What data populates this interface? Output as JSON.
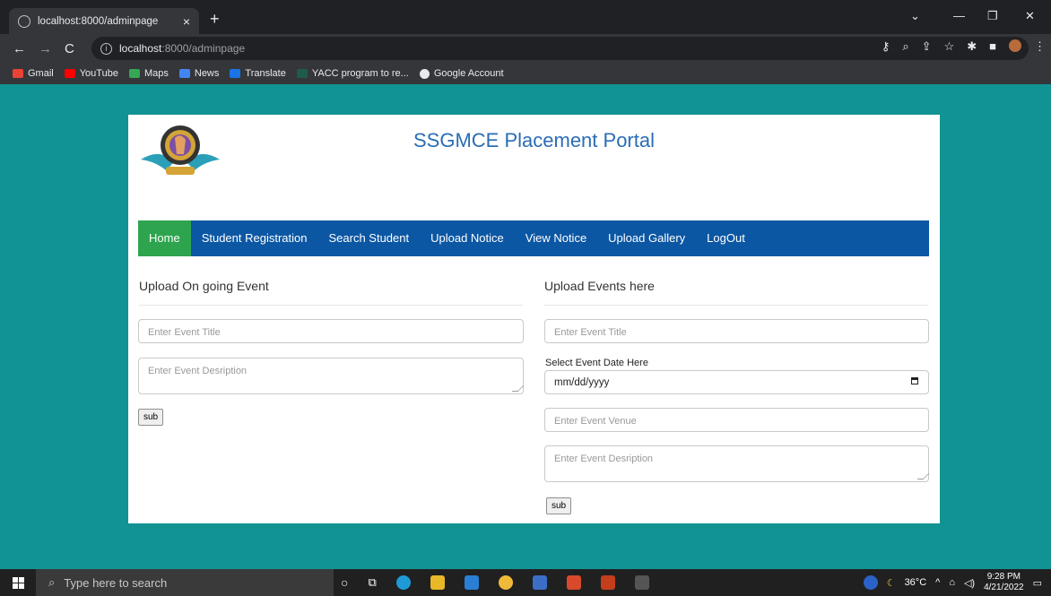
{
  "browser": {
    "tab_title": "localhost:8000/adminpage",
    "close_glyph": "×",
    "newtab_glyph": "+",
    "url_host": "localhost",
    "url_path": ":8000/adminpage",
    "bookmarks": [
      "Gmail",
      "YouTube",
      "Maps",
      "News",
      "Translate",
      "YACC program to re...",
      "Google Account"
    ]
  },
  "page": {
    "title": "SSGMCE Placement Portal",
    "nav": [
      "Home",
      "Student Registration",
      "Search Student",
      "Upload Notice",
      "View Notice",
      "Upload Gallery",
      "LogOut"
    ],
    "left": {
      "heading": "Upload On going Event",
      "title_placeholder": "Enter Event Title",
      "desc_placeholder": "Enter Event Desription",
      "submit": "sub"
    },
    "right": {
      "heading": "Upload Events here",
      "title_placeholder": "Enter Event Title",
      "date_label": "Select Event Date Here",
      "date_value": "mm/dd/yyyy",
      "venue_placeholder": "Enter Event Venue",
      "desc_placeholder": "Enter Event Desription",
      "submit": "sub"
    }
  },
  "taskbar": {
    "search_placeholder": "Type here to search",
    "temperature": "36°C",
    "time": "9:28 PM",
    "date": "4/21/2022"
  },
  "colors": {
    "desktop_bg": "#129393",
    "nav_bg": "#0c57a3",
    "nav_active": "#2ea44f",
    "title_color": "#2a6db5"
  }
}
